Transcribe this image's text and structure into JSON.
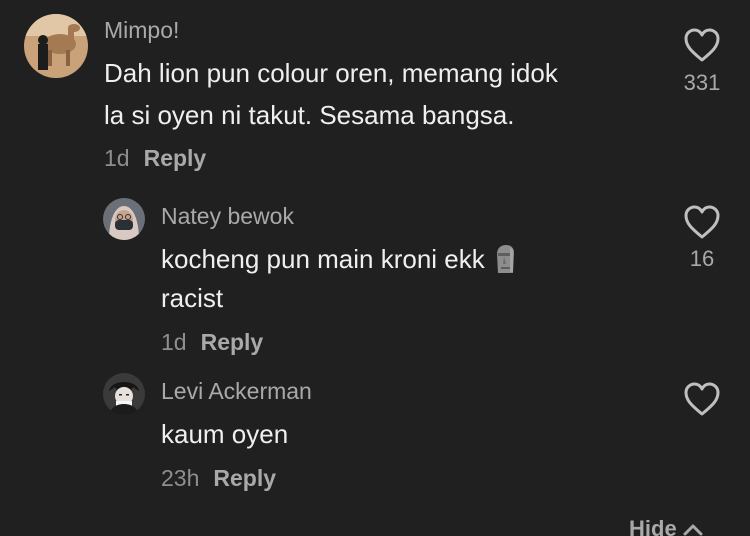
{
  "comments": [
    {
      "username": "Mimpo!",
      "line1": "Dah lion pun colour oren, memang idok",
      "line2": "la si oyen ni takut. Sesama bangsa.",
      "time": "1d",
      "reply_label": "Reply",
      "likes": "331",
      "avatar_icon": "camel-photo-avatar"
    },
    {
      "username": "Natey bewok",
      "line1": "kocheng pun main kroni ekk",
      "line1_emoji": "moai-icon",
      "line2": "racist",
      "time": "1d",
      "reply_label": "Reply",
      "likes": "16",
      "avatar_icon": "hijab-person-avatar"
    },
    {
      "username": "Levi Ackerman",
      "line1": "kaum oyen",
      "time": "23h",
      "reply_label": "Reply",
      "likes": "",
      "avatar_icon": "anime-character-avatar"
    }
  ],
  "hide_label": "Hide",
  "colors": {
    "background": "#202020",
    "username": "#a9a9a9",
    "text": "#efefef",
    "meta": "#8e8e8e"
  }
}
